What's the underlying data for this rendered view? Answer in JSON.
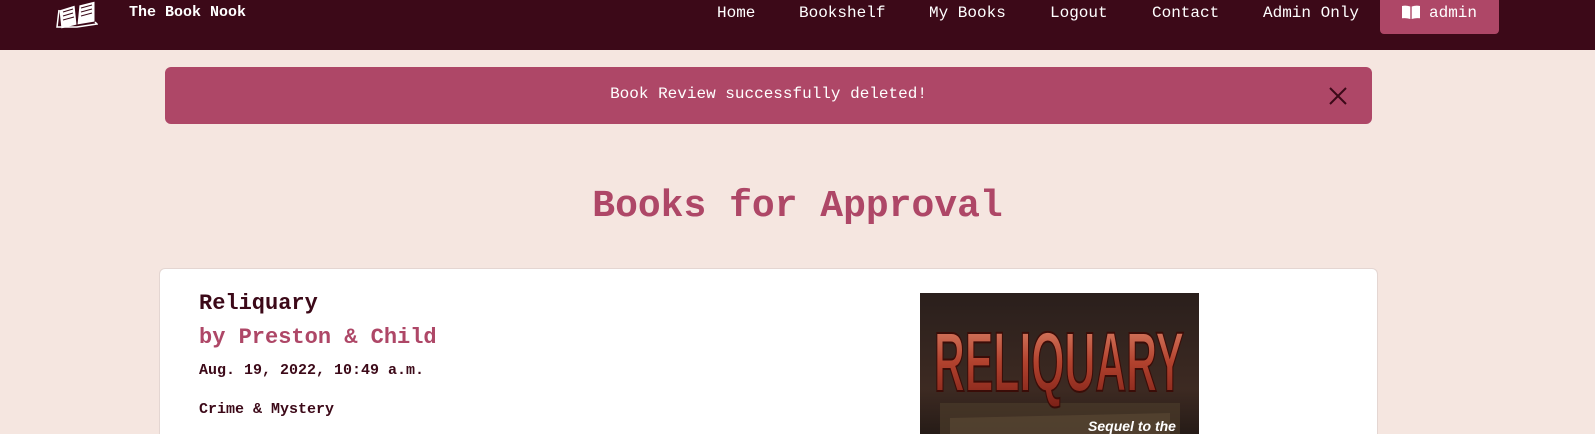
{
  "navbar": {
    "brand": "The Book Nook",
    "links": [
      "Home",
      "Bookshelf",
      "My Books",
      "Logout",
      "Contact",
      "Admin Only"
    ],
    "user_button": "admin",
    "colors": {
      "bar": "#3c0918",
      "accent": "#ae4767"
    }
  },
  "alert": {
    "message": "Book Review successfully deleted!"
  },
  "page": {
    "title": "Books for Approval",
    "background": "#f5e6e0"
  },
  "books": [
    {
      "title": "Reliquary",
      "author": "by Preston & Child",
      "date": "Aug. 19, 2022, 10:49 a.m.",
      "genre": "Crime & Mystery",
      "cover": {
        "title_text": "RELIQUARY",
        "subtitle_text": "Sequel to the"
      }
    }
  ]
}
